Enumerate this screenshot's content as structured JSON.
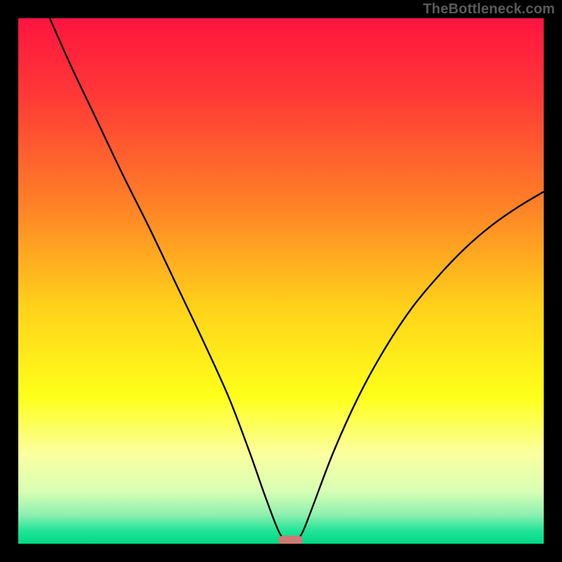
{
  "watermark": "TheBottleneck.com",
  "chart_data": {
    "type": "line",
    "title": "",
    "xlabel": "",
    "ylabel": "",
    "xlim": [
      0,
      100
    ],
    "ylim": [
      0,
      100
    ],
    "series": [
      {
        "name": "curve",
        "x": [
          6,
          10,
          15,
          20,
          25,
          30,
          35,
          40,
          44,
          47,
          49.5,
          51,
          52.5,
          54,
          56,
          60,
          65,
          70,
          75,
          80,
          85,
          90,
          95,
          100
        ],
        "y": [
          100,
          91,
          80.5,
          70,
          60,
          49.5,
          39,
          28,
          17.5,
          9,
          2.5,
          0.5,
          0.5,
          2,
          7,
          17.5,
          28.5,
          37.5,
          45,
          51,
          56.2,
          60.5,
          64,
          67
        ]
      }
    ],
    "marker": {
      "x": 51.8,
      "y": 0.6,
      "color": "#cd7a76"
    },
    "gradient_stops": [
      {
        "offset": 0.0,
        "color": "#ff1440"
      },
      {
        "offset": 0.15,
        "color": "#ff3a36"
      },
      {
        "offset": 0.35,
        "color": "#ff7f27"
      },
      {
        "offset": 0.55,
        "color": "#ffd21a"
      },
      {
        "offset": 0.72,
        "color": "#ffff1a"
      },
      {
        "offset": 0.83,
        "color": "#fbffa0"
      },
      {
        "offset": 0.9,
        "color": "#d8ffb4"
      },
      {
        "offset": 0.945,
        "color": "#8df0b0"
      },
      {
        "offset": 0.975,
        "color": "#22e498"
      },
      {
        "offset": 1.0,
        "color": "#00d884"
      }
    ]
  }
}
